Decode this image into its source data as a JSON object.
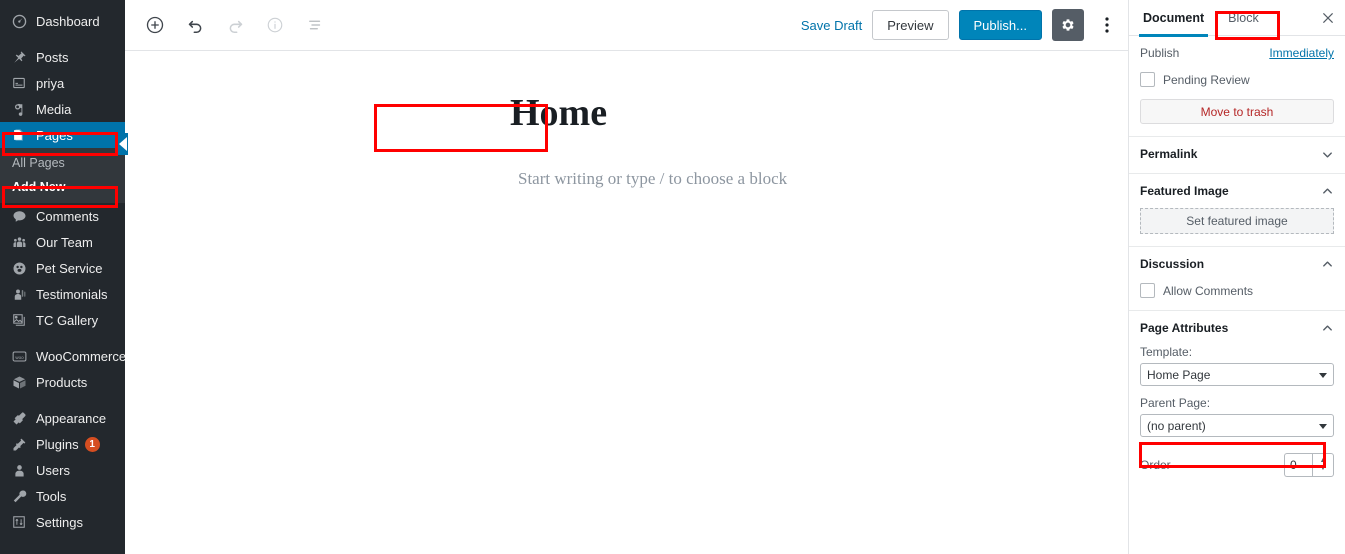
{
  "colors": {
    "sidebar_bg": "#23282d",
    "submenu_bg": "#32373c",
    "current_blue": "#0073aa",
    "publish_blue": "#0085ba",
    "annotation_red": "#ff0000",
    "badge_orange": "#d54e21",
    "trash_red": "#b52727"
  },
  "sidebar": {
    "items": [
      {
        "label": "Dashboard",
        "icon": "dashboard-icon"
      },
      {
        "label": "Posts",
        "icon": "pin-icon"
      },
      {
        "label": "priya",
        "icon": "custom-post-icon"
      },
      {
        "label": "Media",
        "icon": "media-icon"
      },
      {
        "label": "Pages",
        "icon": "pages-icon",
        "current": true
      },
      {
        "label": "Comments",
        "icon": "comments-icon"
      },
      {
        "label": "Our Team",
        "icon": "team-icon"
      },
      {
        "label": "Pet Service",
        "icon": "pet-service-icon"
      },
      {
        "label": "Testimonials",
        "icon": "testimonials-icon"
      },
      {
        "label": "TC Gallery",
        "icon": "gallery-icon"
      },
      {
        "label": "WooCommerce",
        "icon": "woocommerce-icon"
      },
      {
        "label": "Products",
        "icon": "products-icon"
      },
      {
        "label": "Appearance",
        "icon": "appearance-icon"
      },
      {
        "label": "Plugins",
        "icon": "plugins-icon",
        "badge": "1"
      },
      {
        "label": "Users",
        "icon": "users-icon"
      },
      {
        "label": "Tools",
        "icon": "tools-icon"
      },
      {
        "label": "Settings",
        "icon": "settings-icon"
      }
    ],
    "submenu": {
      "all_pages": "All Pages",
      "add_new": "Add New"
    }
  },
  "toolbar": {
    "add_block_icon": "add-block-icon",
    "undo_icon": "undo-icon",
    "redo_icon": "redo-icon",
    "info_icon": "info-icon",
    "list_view_icon": "list-view-icon",
    "save_draft_label": "Save Draft",
    "preview_label": "Preview",
    "publish_label": "Publish...",
    "settings_gear_icon": "gear-icon",
    "more_options_icon": "ellipsis-vertical-icon"
  },
  "editor": {
    "post_title": "Home",
    "block_placeholder": "Start writing or type / to choose a block"
  },
  "rightbar": {
    "tabs": [
      {
        "label": "Document",
        "active": true
      },
      {
        "label": "Block",
        "active": false
      }
    ],
    "close_icon": "close-icon",
    "publish": {
      "label": "Publish",
      "value": "Immediately",
      "pending_review_label": "Pending Review",
      "move_to_trash_label": "Move to trash"
    },
    "permalink": {
      "title": "Permalink",
      "expanded": false
    },
    "featured_image": {
      "title": "Featured Image",
      "expanded": true,
      "set_label": "Set featured image"
    },
    "discussion": {
      "title": "Discussion",
      "expanded": true,
      "allow_comments_label": "Allow Comments"
    },
    "page_attributes": {
      "title": "Page Attributes",
      "expanded": true,
      "template_label": "Template:",
      "template_value": "Home Page",
      "parent_label": "Parent Page:",
      "parent_value": "(no parent)",
      "order_label": "Order",
      "order_value": "0"
    }
  }
}
